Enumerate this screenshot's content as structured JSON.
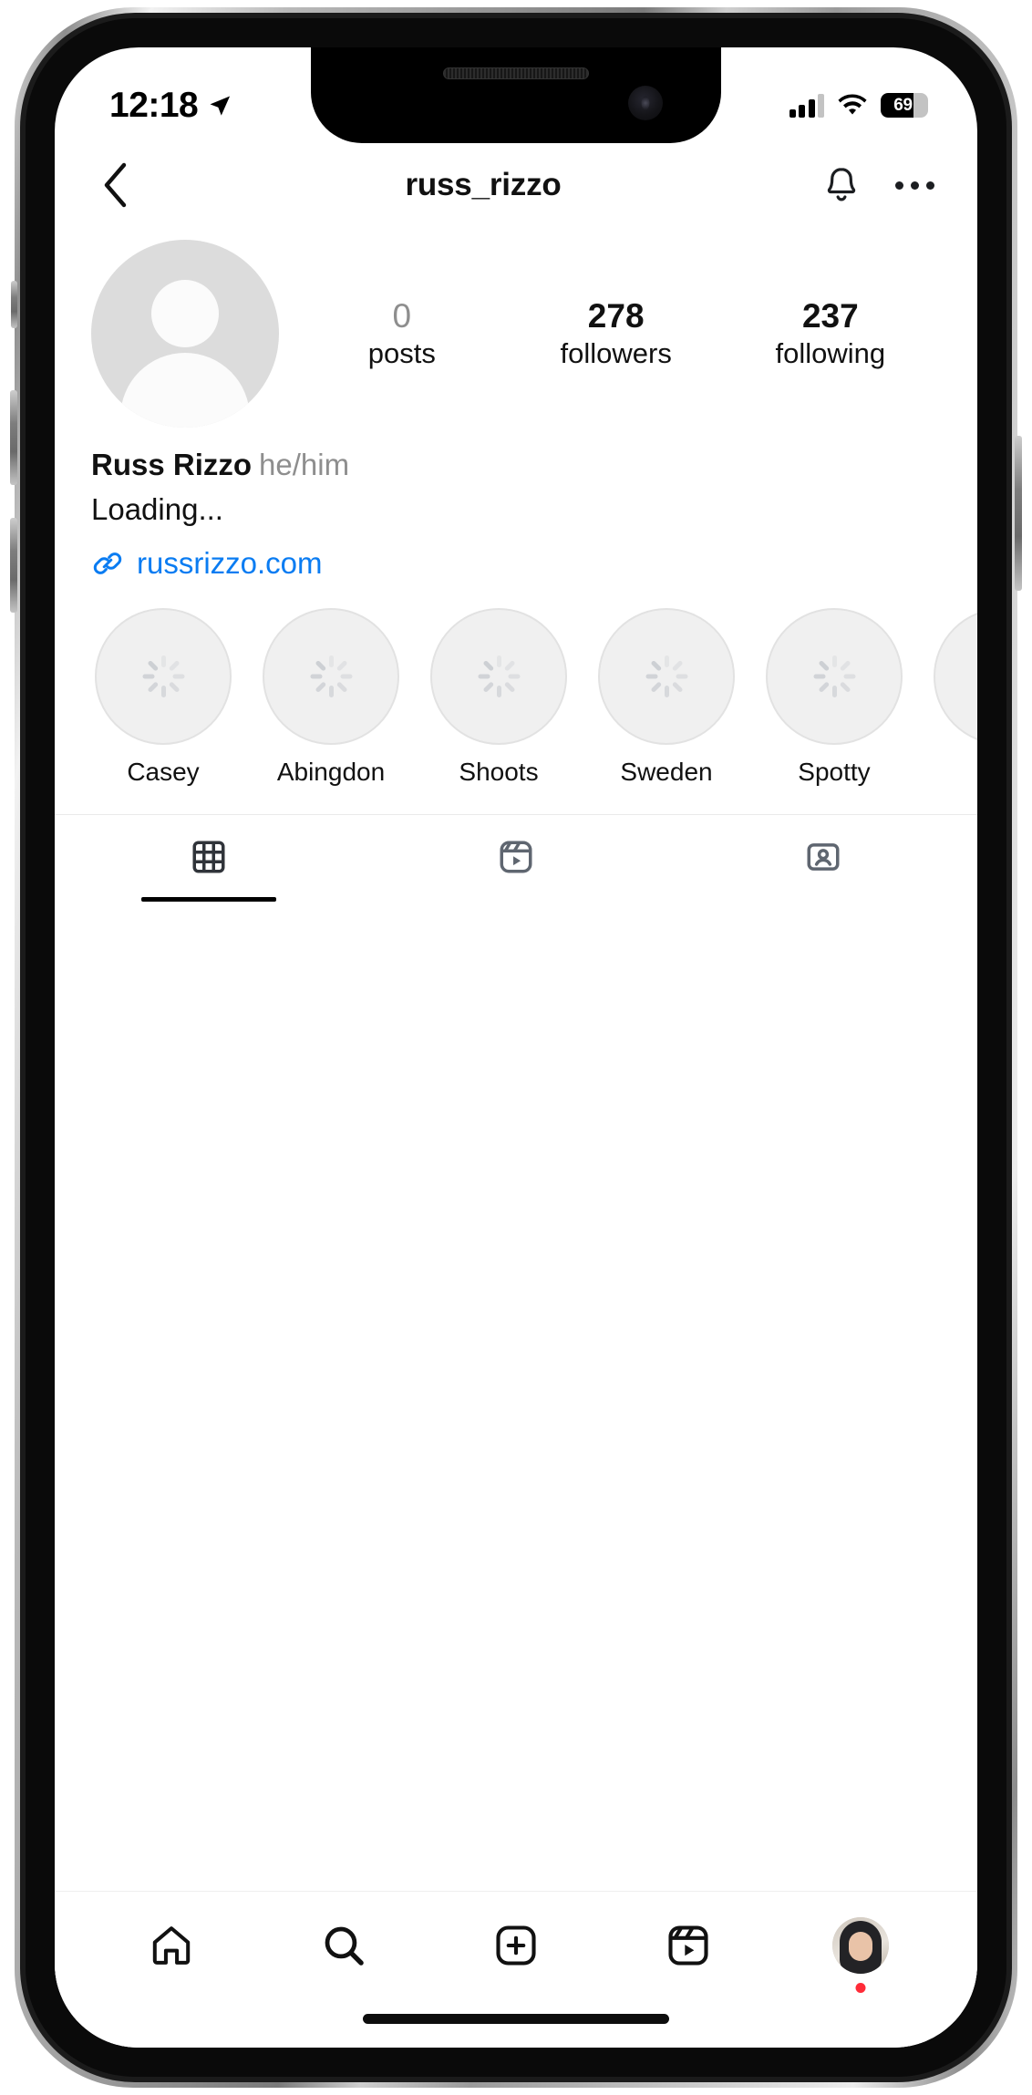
{
  "status_bar": {
    "time": "12:18",
    "location_icon": "location-arrow-icon",
    "signal_icon": "cellular-signal-icon",
    "signal_bars_filled": 3,
    "signal_bars_total": 4,
    "wifi_icon": "wifi-icon",
    "battery_icon": "battery-icon",
    "battery_percent": "69",
    "battery_level": 69
  },
  "navbar": {
    "back_icon": "chevron-left-icon",
    "title": "russ_rizzo",
    "notifications_icon": "bell-icon",
    "more_icon": "more-options-icon"
  },
  "profile": {
    "avatar_icon": "default-avatar-icon",
    "stats": [
      {
        "value": "0",
        "label": "posts",
        "muted": true
      },
      {
        "value": "278",
        "label": "followers",
        "muted": false
      },
      {
        "value": "237",
        "label": "following",
        "muted": false
      }
    ],
    "display_name": "Russ Rizzo",
    "pronouns": "he/him",
    "bio": "Loading...",
    "link_icon": "link-chain-icon",
    "link_text": "russrizzo.com",
    "link_color": "#0a7cf2"
  },
  "highlights": [
    {
      "label": "Casey",
      "icon": "loading-spinner-icon"
    },
    {
      "label": "Abingdon",
      "icon": "loading-spinner-icon"
    },
    {
      "label": "Shoots",
      "icon": "loading-spinner-icon"
    },
    {
      "label": "Sweden",
      "icon": "loading-spinner-icon"
    },
    {
      "label": "Spotty",
      "icon": "loading-spinner-icon"
    },
    {
      "label": "",
      "icon": "loading-spinner-icon"
    }
  ],
  "tabs": [
    {
      "name": "grid-tab",
      "icon": "grid-icon",
      "active": true
    },
    {
      "name": "reels-tab",
      "icon": "reels-icon",
      "active": false
    },
    {
      "name": "tagged-tab",
      "icon": "tagged-person-icon",
      "active": false
    }
  ],
  "bottom_nav": [
    {
      "name": "home",
      "icon": "home-icon"
    },
    {
      "name": "search",
      "icon": "search-icon"
    },
    {
      "name": "create",
      "icon": "plus-square-icon"
    },
    {
      "name": "reels",
      "icon": "reels-icon"
    },
    {
      "name": "profile",
      "icon": "profile-avatar-icon",
      "badge": true
    }
  ],
  "colors": {
    "accent_link": "#0a7cf2",
    "text_primary": "#111111",
    "text_muted": "#8e8e8e",
    "badge": "#ff2b38",
    "tab_inactive": "#6b727c"
  }
}
